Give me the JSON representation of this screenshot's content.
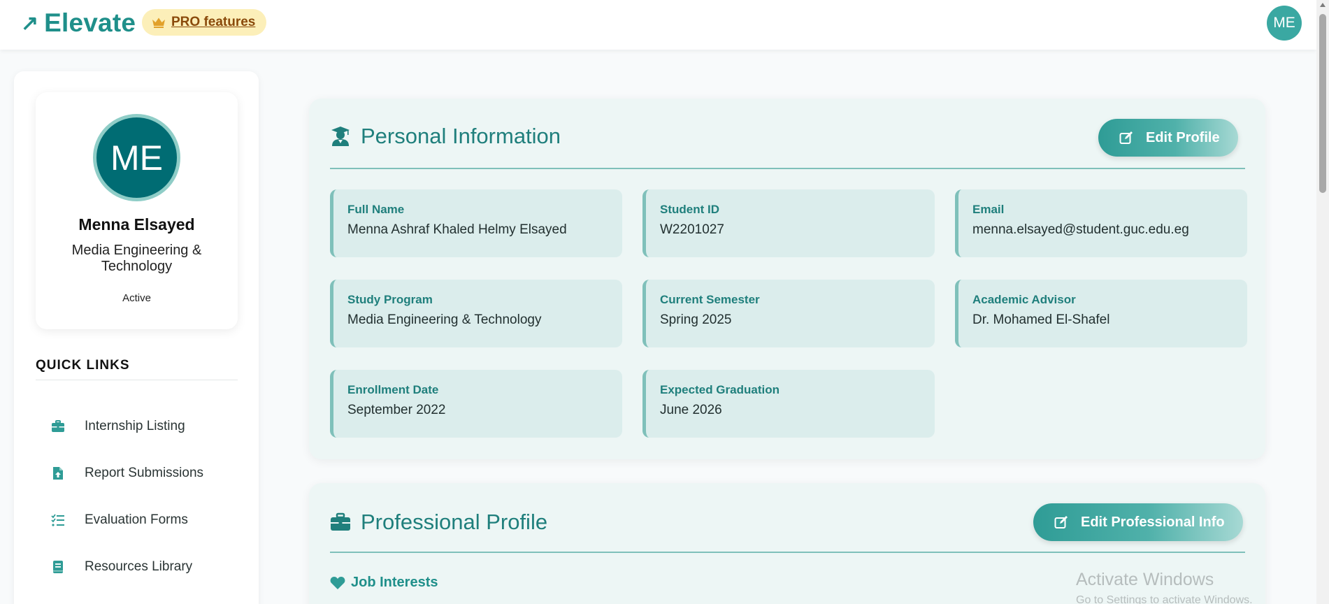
{
  "app": {
    "logo_text": "Elevate",
    "pro_label": "PRO features",
    "user_initials": "ME"
  },
  "colors": {
    "brand": "#1f8f8a",
    "accent": "#006c73",
    "panel_bg": "#edf6f5",
    "field_bg": "#dbedec",
    "pro_badge_bg": "#fcefb9"
  },
  "profile": {
    "initials": "ME",
    "name": "Menna Elsayed",
    "program": "Media Engineering & Technology",
    "status": "Active"
  },
  "quick_links": {
    "title": "QUICK LINKS",
    "items": [
      {
        "label": "Internship Listing",
        "icon": "briefcase-icon"
      },
      {
        "label": "Report Submissions",
        "icon": "file-upload-icon"
      },
      {
        "label": "Evaluation Forms",
        "icon": "checklist-icon"
      },
      {
        "label": "Resources Library",
        "icon": "book-icon"
      }
    ]
  },
  "personal": {
    "title": "Personal Information",
    "edit_label": "Edit Profile",
    "fields": [
      {
        "label": "Full Name",
        "value": "Menna Ashraf Khaled Helmy Elsayed"
      },
      {
        "label": "Student ID",
        "value": "W2201027"
      },
      {
        "label": "Email",
        "value": "menna.elsayed@student.guc.edu.eg"
      },
      {
        "label": "Study Program",
        "value": "Media Engineering & Technology"
      },
      {
        "label": "Current Semester",
        "value": "Spring 2025"
      },
      {
        "label": "Academic Advisor",
        "value": "Dr. Mohamed El-Shafel"
      },
      {
        "label": "Enrollment Date",
        "value": "September 2022"
      },
      {
        "label": "Expected Graduation",
        "value": "June 2026"
      }
    ]
  },
  "professional": {
    "title": "Professional Profile",
    "edit_label": "Edit Professional Info",
    "job_interests_label": "Job Interests"
  },
  "watermark": {
    "line1": "Activate Windows",
    "line2": "Go to Settings to activate Windows."
  }
}
